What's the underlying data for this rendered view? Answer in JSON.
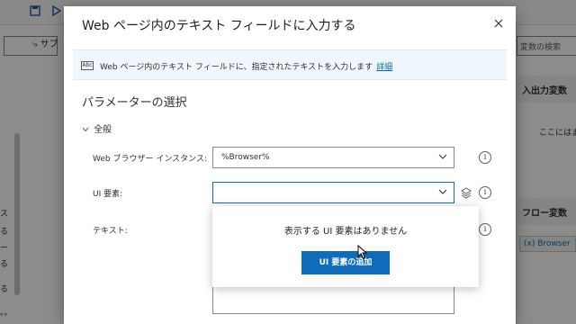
{
  "background": {
    "left_side_chars": [
      "ス",
      "る",
      "ー",
      "る",
      "る"
    ],
    "left_bottom_text": "。。",
    "subflow_label": "サブ",
    "variable_search_placeholder": "変数の検索",
    "io_vars_header": "入出力変数",
    "io_vars_text": "ここにはま",
    "flow_vars_header": "フロー変数",
    "flow_var_chip": "Browser",
    "flow_var_chip_icon": "(x)"
  },
  "dialog": {
    "title": "Web ページ内のテキスト フィールドに入力する",
    "info_icon_label": "Abc",
    "info_text": "Web ページ内のテキスト フィールドに、指定されたテキストを入力します",
    "info_link": "詳細",
    "section_title": "パラメーターの選択",
    "group_label": "全般",
    "fields": {
      "browser_instance": {
        "label": "Web ブラウザー インスタンス:",
        "value": "%Browser%"
      },
      "ui_element": {
        "label": "UI 要素:",
        "value": ""
      },
      "text": {
        "label": "テキスト:"
      }
    },
    "help_glyph": "i",
    "popup": {
      "message": "表示する UI 要素はありません",
      "add_button": "UI 要素の追加"
    }
  }
}
